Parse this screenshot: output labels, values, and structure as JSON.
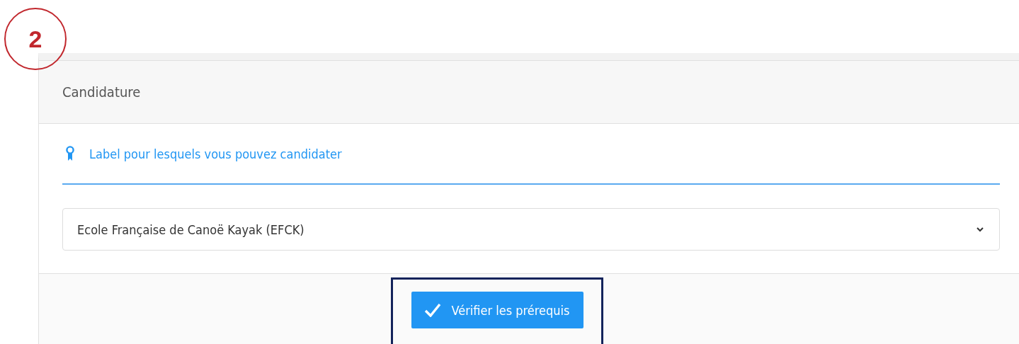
{
  "step_badge": "2",
  "card": {
    "title": "Candidature",
    "section_heading": "Label pour lesquels vous pouvez candidater",
    "select": {
      "value": "Ecole Française de Canoë Kayak (EFCK)"
    },
    "button": "Vérifier les prérequis"
  }
}
